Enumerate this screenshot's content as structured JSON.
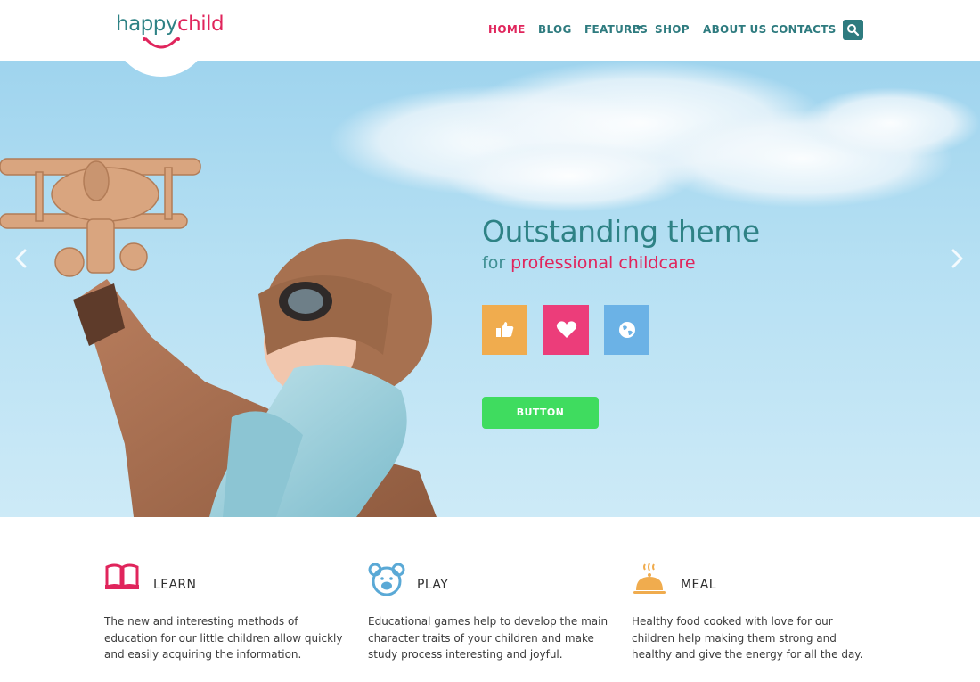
{
  "logo": {
    "part1": "happy",
    "part2": "child"
  },
  "nav": {
    "items": [
      {
        "label": "HOME",
        "active": true
      },
      {
        "label": "BLOG",
        "active": false
      },
      {
        "label": "FEATURES",
        "active": false
      },
      {
        "label": "SHOP",
        "active": false
      },
      {
        "label": "ABOUT US",
        "active": false
      },
      {
        "label": "CONTACTS",
        "active": false
      }
    ],
    "search_icon": "search-icon"
  },
  "hero": {
    "title": "Outstanding theme",
    "subtitle_prefix": "for",
    "subtitle_highlight": "professional childcare",
    "tiles": [
      {
        "icon": "thumbs-up-icon",
        "color": "#f0ac4e"
      },
      {
        "icon": "heart-icon",
        "color": "#ec3d7a"
      },
      {
        "icon": "globe-icon",
        "color": "#6bb2e6"
      }
    ],
    "button_label": "BUTTON",
    "button_color": "#3fdc5f"
  },
  "features": [
    {
      "icon": "book-icon",
      "title": "LEARN",
      "text": "The new and interesting methods of education for our little children allow quickly and easily acquiring the information."
    },
    {
      "icon": "bear-icon",
      "title": "PLAY",
      "text": "Educational games help to develop the main character traits of your children and make study process interesting and joyful."
    },
    {
      "icon": "food-cloche-icon",
      "title": "MEAL",
      "text": "Healthy food cooked with love for our children help making them strong and healthy and give the energy for all the day."
    }
  ],
  "colors": {
    "accent": "#e0255c",
    "teal": "#2e7b7f"
  }
}
